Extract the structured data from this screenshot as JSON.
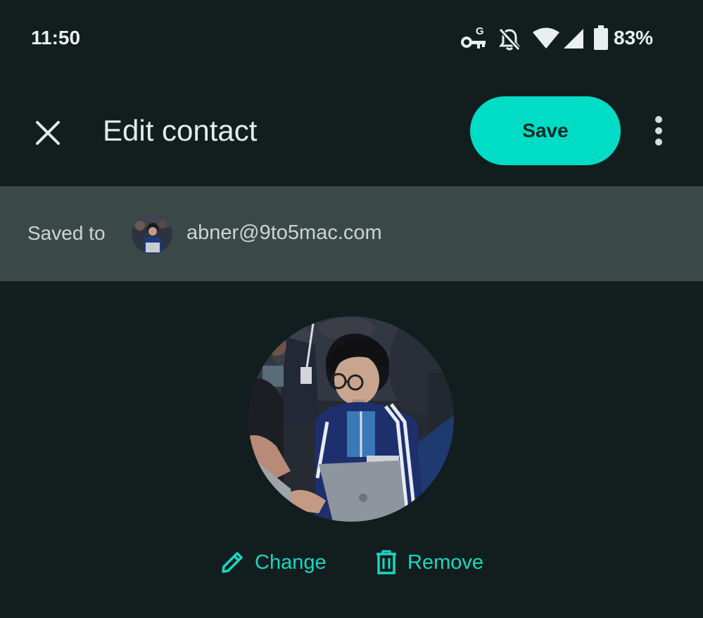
{
  "status_bar": {
    "time": "11:50",
    "battery_percent": "83%",
    "icons": [
      "vpn-key-icon",
      "bell-off-icon",
      "wifi-icon",
      "cell-signal-icon",
      "battery-icon"
    ]
  },
  "header": {
    "title": "Edit contact",
    "save_label": "Save",
    "close_icon": "close-icon",
    "more_icon": "more-vert-icon"
  },
  "account": {
    "saved_to_label": "Saved to",
    "email": "abner@9to5mac.com"
  },
  "photo_actions": {
    "change_label": "Change",
    "remove_label": "Remove"
  },
  "colors": {
    "background": "#111e1d",
    "account_bar": "#3a4946",
    "accent": "#00dcc5",
    "action_text": "#19d6c3"
  }
}
